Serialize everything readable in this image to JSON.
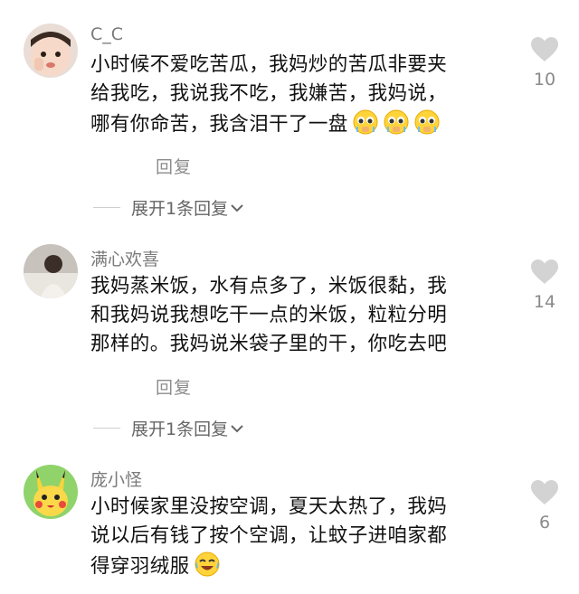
{
  "comments": [
    {
      "username": "C_C",
      "lines": [
        "小时候不爱吃苦瓜，我妈炒的苦瓜非要夹",
        "给我吃，我说我不吃，我嫌苦，我妈说，",
        "哪有你命苦，我含泪干了一盘"
      ],
      "reply_label": "回复",
      "expand_label": "展开1条回复",
      "like_count": "10",
      "trailing_emojis": [
        "crying-pleading-emoji",
        "crying-pleading-emoji",
        "crying-pleading-emoji"
      ]
    },
    {
      "username": "满心欢喜",
      "lines": [
        "我妈蒸米饭，水有点多了，米饭很黏，我",
        "和我妈说我想吃干一点的米饭，粒粒分明",
        "那样的。我妈说米袋子里的干，你吃去吧"
      ],
      "reply_label": "回复",
      "expand_label": "展开1条回复",
      "like_count": "14"
    },
    {
      "username": "庞小怪",
      "lines": [
        "小时候家里没按空调，夏天太热了，我妈",
        "说以后有钱了按个空调，让蚊子进咱家都",
        "得穿羽绒服"
      ],
      "like_count": "6",
      "trailing_emojis": [
        "tears-of-joy-emoji"
      ]
    }
  ]
}
